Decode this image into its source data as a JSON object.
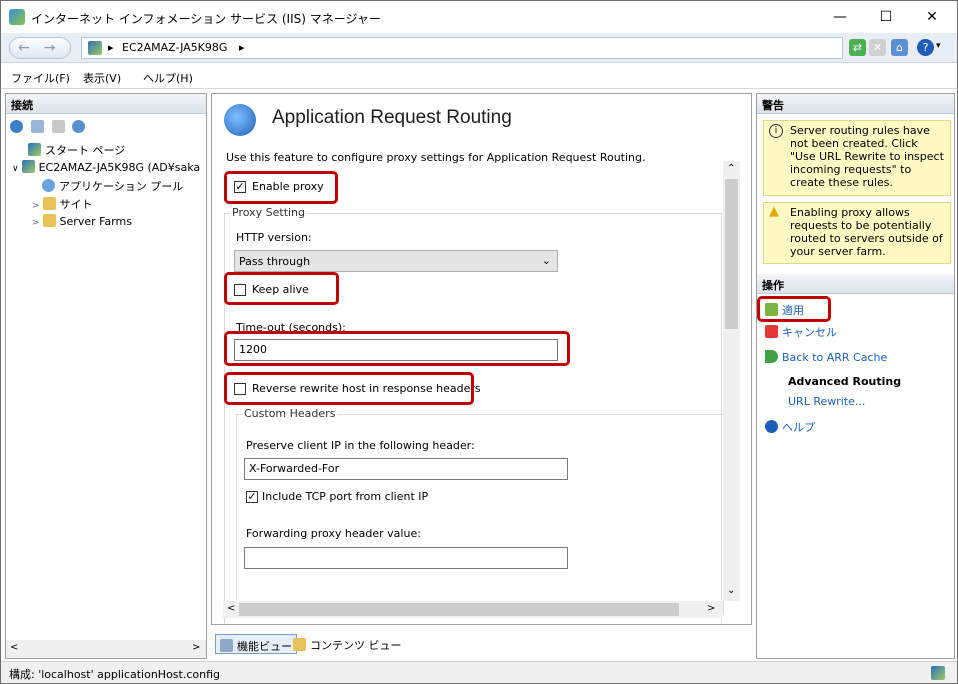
{
  "window": {
    "title": "インターネット インフォメーション サービス (IIS) マネージャー",
    "minimize": "—",
    "maximize": "☐",
    "close": "✕"
  },
  "address": {
    "arrow1": "▸",
    "host": "EC2AMAZ-JA5K98G",
    "arrow2": "▸"
  },
  "menu": [
    "ファイル(F)",
    "表示(V)",
    "ヘルプ(H)"
  ],
  "left": {
    "header": "接続",
    "tree": [
      {
        "label": "スタート ページ",
        "icon": "start-page-icon"
      },
      {
        "label": "EC2AMAZ-JA5K98G (AD¥saka",
        "icon": "server-icon",
        "expander": "∨"
      },
      {
        "label": "アプリケーション プール",
        "icon": "app-pool-icon"
      },
      {
        "label": "サイト",
        "icon": "sites-folder-icon",
        "expander": ">"
      },
      {
        "label": "Server Farms",
        "icon": "server-farms-icon",
        "expander": ">"
      }
    ]
  },
  "center": {
    "title": "Application Request Routing",
    "description": "Use this feature to configure proxy settings for Application Request Routing.",
    "enable_proxy": {
      "label": "Enable proxy",
      "checked": true
    },
    "proxy_setting_group": "Proxy Setting",
    "http_version_label": "HTTP version:",
    "http_version_value": "Pass through",
    "keep_alive": {
      "label": "Keep alive",
      "checked": false
    },
    "timeout_label": "Time-out (seconds):",
    "timeout_value": "1200",
    "reverse_rewrite": {
      "label": "Reverse rewrite host in response headers",
      "checked": false
    },
    "custom_headers_group": "Custom Headers",
    "preserve_ip_label": "Preserve client IP in the following header:",
    "preserve_ip_value": "X-Forwarded-For",
    "include_tcp_port": {
      "label": "Include TCP port from client IP",
      "checked": true
    },
    "forwarding_label": "Forwarding proxy header value:",
    "forwarding_value": ""
  },
  "view_tabs": [
    "機能ビュー",
    "コンテンツ ビュー"
  ],
  "right": {
    "alerts_header": "警告",
    "alert1": "Server routing rules have not been created. Click \"Use URL Rewrite to inspect incoming requests\" to create these rules.",
    "alert2": "Enabling proxy allows requests to be potentially routed to servers outside of your server farm.",
    "actions_header": "操作",
    "apply": "適用",
    "cancel": "キャンセル",
    "back": "Back to ARR Cache",
    "advanced_routing": "Advanced Routing",
    "url_rewrite": "URL Rewrite...",
    "help": "ヘルプ"
  },
  "status": {
    "text": "構成: 'localhost' applicationHost.config"
  },
  "colors": {
    "highlight": "#c00000",
    "link": "#1f5eb8",
    "alert_bg": "#fff9c4"
  }
}
